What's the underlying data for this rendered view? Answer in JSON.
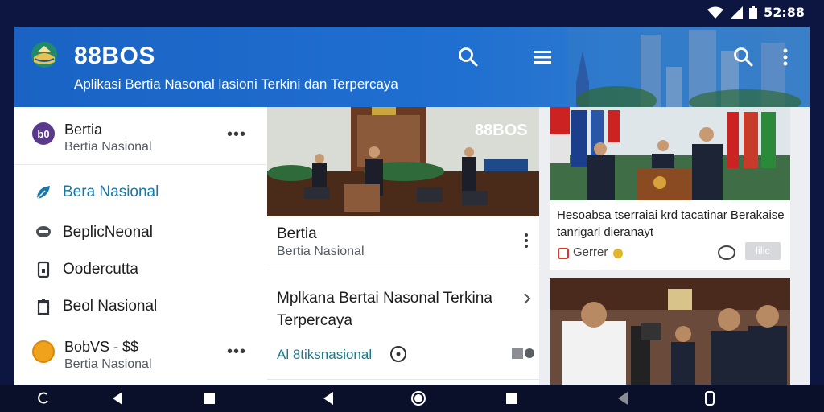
{
  "status_bar": {
    "time": "52:88"
  },
  "app": {
    "title": "88BOS",
    "subtitle": "Aplikasi Bertia Nasonal lasioni Terkini dan Terpercaya",
    "icons": [
      "search-icon",
      "menu-icon",
      "search-icon",
      "more-vert-icon"
    ]
  },
  "drawer": {
    "header": {
      "avatar_text": "b0",
      "title": "Bertia",
      "subtitle": "Bertia Nasional",
      "more": "•••"
    },
    "items": [
      {
        "label": "Bera Nasional",
        "icon": "leaf-icon",
        "active": true
      },
      {
        "label": "BeplicNeonal",
        "icon": "chat-icon",
        "active": false
      },
      {
        "label": "Oodercutta",
        "icon": "phone-icon",
        "active": false
      },
      {
        "label": "Beol Nasional",
        "icon": "trash-icon",
        "active": false
      }
    ],
    "footer": {
      "title": "BobVS - ⚐ $",
      "title_text": "BobVS - $$",
      "subtitle": "Bertia Nasional",
      "more": "•••"
    }
  },
  "middle": {
    "photo_caption": "88BOS",
    "card_title": "Bertia",
    "card_subtitle": "Bertia Nasional",
    "headline": "Mplkana Bertai Nasonal Terkina Terpercaya",
    "source": "Al 8tiksnasional"
  },
  "right": {
    "card1": {
      "text": "Hesoabsa tserraiai krd tacatinar Berakaise tanrigarl dieranayt",
      "source": "Gerrer",
      "badge": "lilic"
    }
  },
  "colors": {
    "appbar": "#1a63c4",
    "accent": "#1677a8",
    "navbar": "#0a0f2a"
  }
}
